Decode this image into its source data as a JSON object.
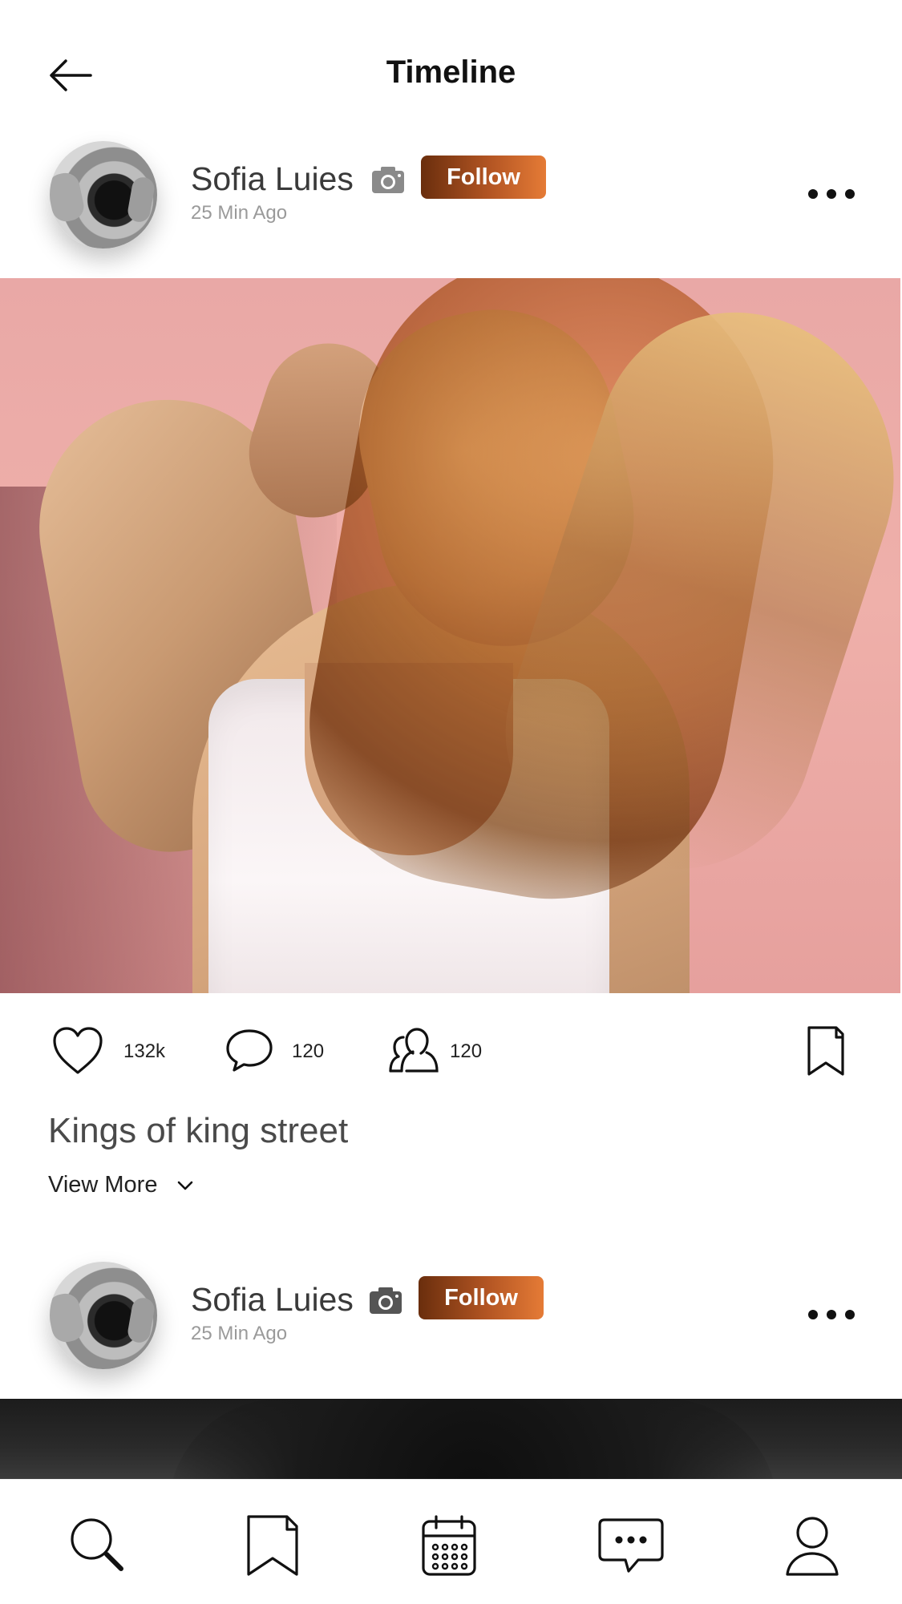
{
  "header": {
    "title": "Timeline",
    "back_icon": "arrow-left-icon"
  },
  "posts": [
    {
      "author": "Sofia Luies",
      "author_icon": "camera-icon",
      "follow_label": "Follow",
      "time_ago": "25 Min Ago",
      "more_icon": "more-dots-icon",
      "image_description": "",
      "likes": "132k",
      "comments": "120",
      "shares": "120",
      "caption": "Kings of king street",
      "view_more": "View More"
    },
    {
      "author": "Sofia Luies",
      "author_icon": "camera-icon",
      "follow_label": "Follow",
      "time_ago": "25 Min Ago",
      "more_icon": "more-dots-icon"
    }
  ],
  "bottom_nav": {
    "items": [
      "search-icon",
      "bookmark-icon",
      "calendar-icon",
      "chat-icon",
      "profile-icon"
    ]
  },
  "colors": {
    "follow_gradient_start": "#6a2e0d",
    "follow_gradient_end": "#e57b36"
  }
}
